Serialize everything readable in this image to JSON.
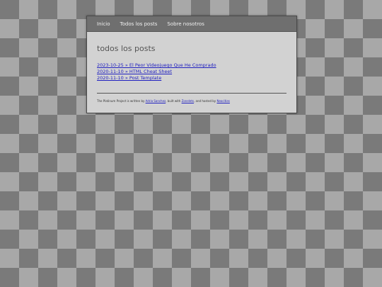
{
  "nav": {
    "items": [
      {
        "label": "Inicio"
      },
      {
        "label": "Todos los posts"
      },
      {
        "label": "Sobre nosotros"
      }
    ]
  },
  "main": {
    "title": "todos los posts",
    "posts": [
      {
        "date": "2023-10-25",
        "title": "El Peor Videojuego Que He Comprado",
        "text": "2023-10-25 » El Peor Videojuego Que He Comprado"
      },
      {
        "date": "2020-11-10",
        "title": "HTML Cheat Sheet",
        "text": "2020-11-10 » HTML Cheat Sheet"
      },
      {
        "date": "2020-11-10",
        "title": "Post Template",
        "text": "2020-11-10 » Post Template"
      }
    ]
  },
  "footer": {
    "text1": "The Platinum Project is written by ",
    "author": "Adria Sanchez",
    "text2": ", built with ",
    "tool": "Zonelets",
    "text3": ", and hosted by ",
    "host": "Neocities"
  },
  "colors": {
    "checker_light": "#a8a8a8",
    "checker_dark": "#7a7a7a",
    "nav_bg": "#6f6f6f",
    "page_bg": "#d2d2d2",
    "link": "#2020c0"
  }
}
